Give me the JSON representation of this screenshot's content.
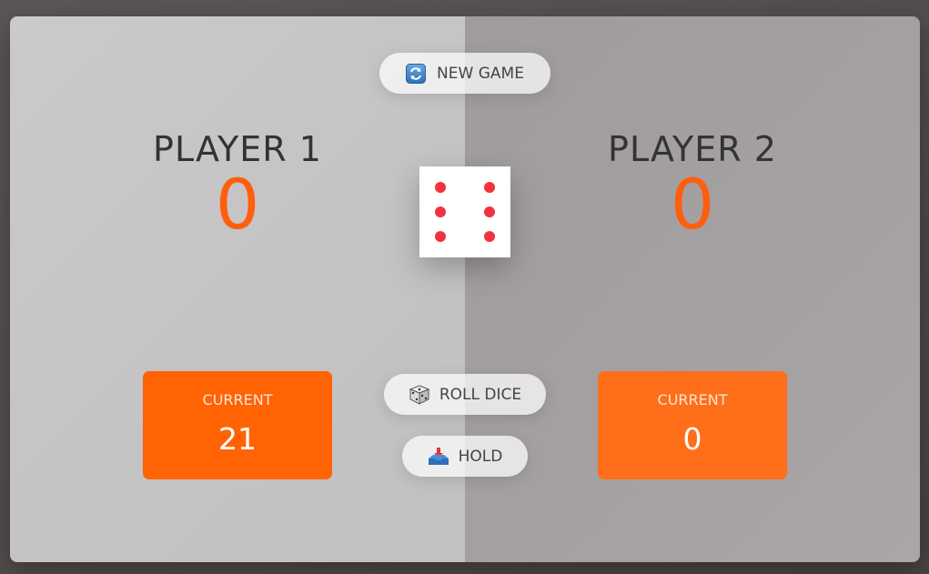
{
  "players": [
    {
      "name": "PLAYER 1",
      "score": "0",
      "current_label": "CURRENT",
      "current_score": "21"
    },
    {
      "name": "PLAYER 2",
      "score": "0",
      "current_label": "CURRENT",
      "current_score": "0"
    }
  ],
  "buttons": {
    "new_game": {
      "label": "NEW GAME",
      "icon": "refresh-icon"
    },
    "roll_dice": {
      "label": "ROLL DICE",
      "icon": "dice-icon"
    },
    "hold": {
      "label": "HOLD",
      "icon": "inbox-tray-icon"
    }
  },
  "dice": {
    "value": 6
  },
  "colors": {
    "accent": "#ff5e0d",
    "pip": "#f2323c"
  }
}
